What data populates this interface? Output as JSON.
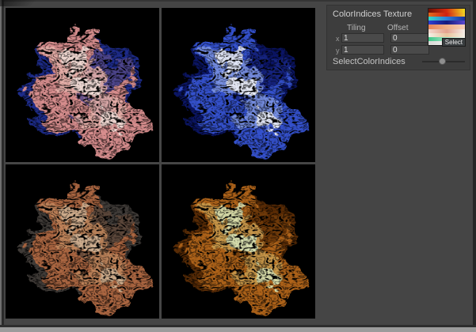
{
  "preview": {
    "quadrants": [
      {
        "id": "top-left",
        "description": "pink-red smoke render with dark blue patches",
        "colors": {
          "bg": "#000000",
          "accent": "#1f2d8e",
          "base": "#d98f8f",
          "mid": "#e8b3ac",
          "bright": "#f7e6e0"
        },
        "opacity": 1
      },
      {
        "id": "top-right",
        "description": "blue-white smoke render",
        "colors": {
          "bg": "#000000",
          "accent": "#0c1668",
          "base": "#3552cf",
          "mid": "#7e97e8",
          "bright": "#ffffff"
        },
        "opacity": 1
      },
      {
        "id": "bottom-left",
        "description": "dim gray-orange smoke render",
        "colors": {
          "bg": "#000000",
          "accent": "#4a4440",
          "base": "#c0734a",
          "mid": "#d99868",
          "bright": "#efcfae"
        },
        "opacity": 0.9
      },
      {
        "id": "bottom-right",
        "description": "orange smoke render with pale green highlights",
        "colors": {
          "bg": "#000000",
          "accent": "#5c2d06",
          "base": "#b0641a",
          "mid": "#cfa050",
          "bright": "#ddefc2"
        },
        "opacity": 1
      }
    ]
  },
  "inspector": {
    "texture_label": "ColorIndices Texture",
    "tiling_header": "Tiling",
    "offset_header": "Offset",
    "rows": [
      {
        "axis": "x",
        "tiling": "1",
        "offset": "0"
      },
      {
        "axis": "y",
        "tiling": "1",
        "offset": "0"
      }
    ],
    "select_button": "Select",
    "slider_label": "SelectColorIndices",
    "slider_value_fraction": 0.46,
    "thumbnail_stripes": [
      [
        "#6e1005",
        "#d42b10",
        "#f0dc1e"
      ],
      [
        "#e06a1e",
        "#cf2012",
        "#f2cf2a"
      ],
      [
        "#35d8c8",
        "#2f7fd8",
        "#1a2f9e"
      ],
      [
        "#2e3fd4",
        "#141b7c",
        "#5a48d0"
      ],
      [
        "#e8875a",
        "#efae85",
        "#f6d0b8"
      ],
      [
        "#f3d9ce",
        "#e3a28e",
        "#f6efe9"
      ],
      [
        "#f2efe6",
        "#e9c49e",
        "#f4efe7"
      ],
      [
        "#3ec787",
        "#9fe2c4",
        "#f2f7f1"
      ],
      [
        "#d9d9d6",
        "#efefed",
        "#e6e6e3"
      ]
    ]
  },
  "colors": {
    "app_bg": "#454545",
    "panel_bg": "#3d3d3d",
    "preview_bg": "#000000"
  }
}
